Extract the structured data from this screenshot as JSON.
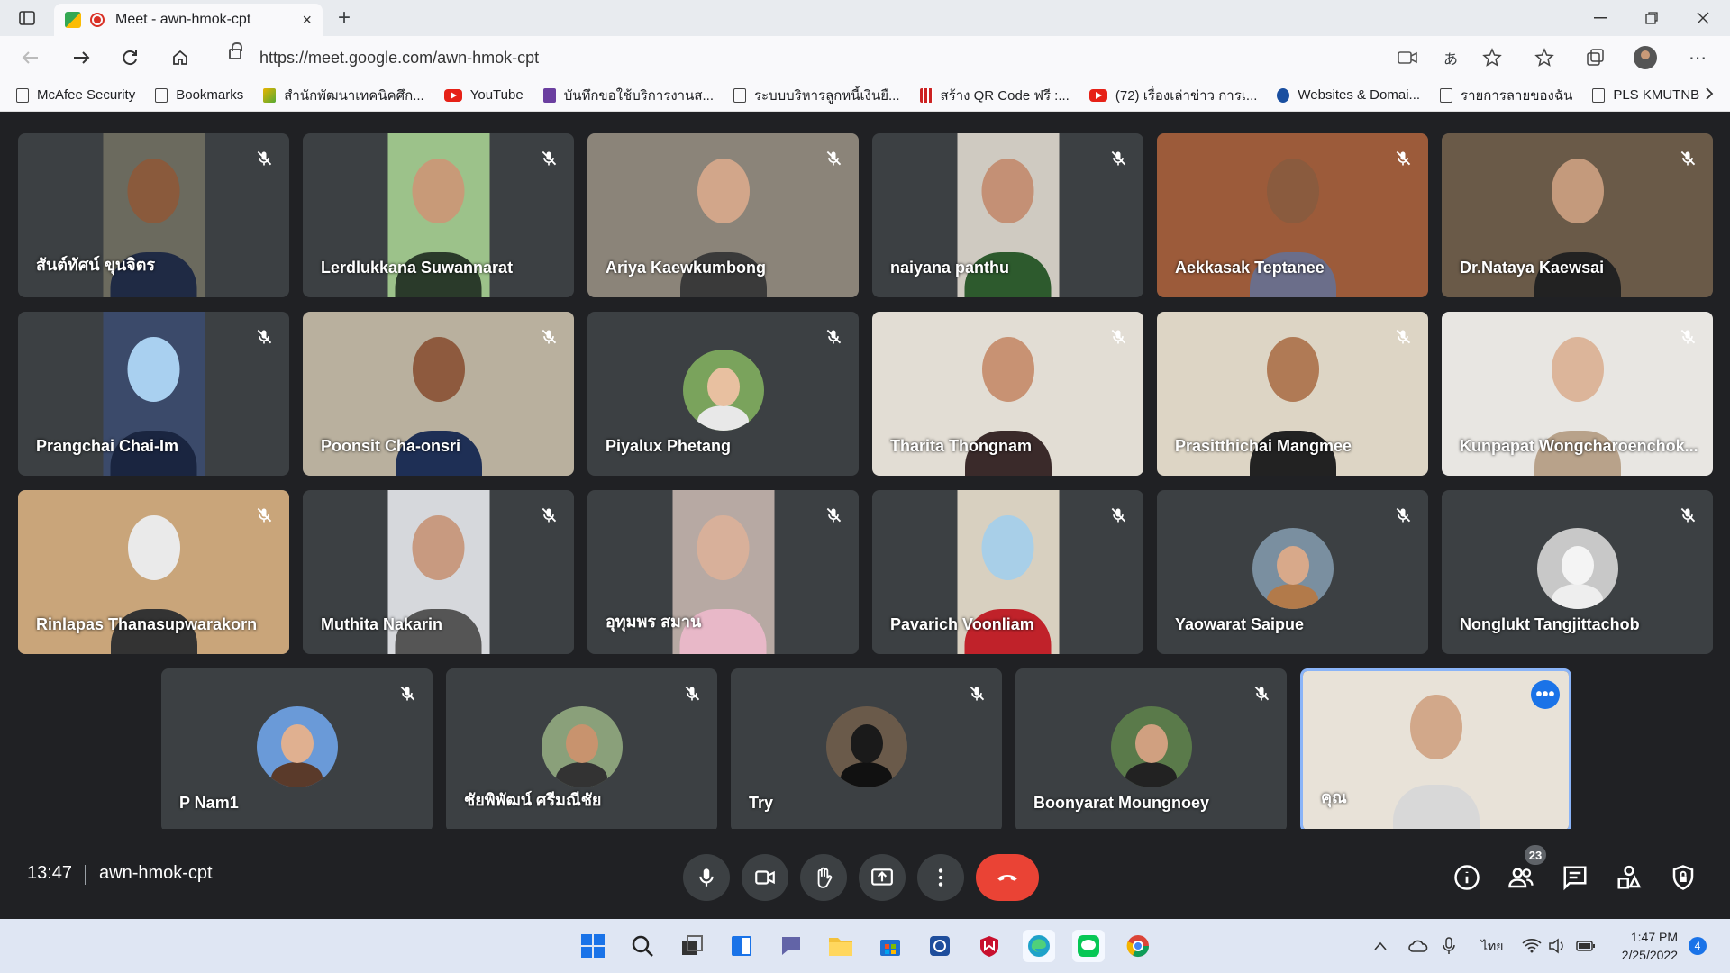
{
  "browser": {
    "tab_title": "Meet - awn-hmok-cpt",
    "tab_close": "×",
    "new_tab": "+",
    "url": "https://meet.google.com/awn-hmok-cpt",
    "bookmarks": [
      {
        "label": "McAfee Security",
        "icon": "page"
      },
      {
        "label": "Bookmarks",
        "icon": "page"
      },
      {
        "label": "สำนักพัฒนาเทคนิคศึก...",
        "icon": "col"
      },
      {
        "label": "YouTube",
        "icon": "yt"
      },
      {
        "label": "บันทึกขอใช้บริการงานส...",
        "icon": "sq"
      },
      {
        "label": "ระบบบริหารลูกหนี้เงินยื...",
        "icon": "page"
      },
      {
        "label": "สร้าง QR Code ฟรี :...",
        "icon": "qr"
      },
      {
        "label": "(72) เรื่องเล่าข่าว การเ...",
        "icon": "yt"
      },
      {
        "label": "Websites & Domai...",
        "icon": "pw"
      },
      {
        "label": "รายการลายของฉัน",
        "icon": "page"
      },
      {
        "label": "PLS KMUTNB",
        "icon": "page"
      }
    ]
  },
  "participants": [
    {
      "name": "สันต์ทัศน์ ขุนจิตร",
      "mode": "video",
      "bg": "#6b6a5e",
      "face": "#8a5a3c",
      "body": "#1f2a44",
      "full": false
    },
    {
      "name": "Lerdlukkana Suwannarat",
      "mode": "video",
      "bg": "#9cc28a",
      "face": "#c89a78",
      "body": "#2a3a2a",
      "full": false
    },
    {
      "name": "Ariya Kaewkumbong",
      "mode": "video",
      "bg": "#8b8479",
      "face": "#d2a68a",
      "body": "#3a3a3a",
      "full": true
    },
    {
      "name": "naiyana panthu",
      "mode": "video",
      "bg": "#cfcac1",
      "face": "#c49075",
      "body": "#2d5a2d",
      "full": false
    },
    {
      "name": "Aekkasak Teptanee",
      "mode": "video",
      "bg": "#9c5b3a",
      "face": "#8a5b3e",
      "body": "#6b6e8a",
      "full": true
    },
    {
      "name": "Dr.Nataya Kaewsai",
      "mode": "video",
      "bg": "#6a5a48",
      "face": "#c49a7c",
      "body": "#222",
      "full": true
    },
    {
      "name": "Prangchai Chai-Im",
      "mode": "video",
      "bg": "#3b4a6a",
      "face": "#a9d0f0",
      "body": "#1a2540",
      "full": false
    },
    {
      "name": "Poonsit Cha-onsri",
      "mode": "video",
      "bg": "#b9b09e",
      "face": "#8e5a3e",
      "body": "#1e2f55",
      "full": true
    },
    {
      "name": "Piyalux Phetang",
      "mode": "avatar",
      "avbg": "#7aa35c",
      "face": "#e8c0a0",
      "body": "#e8e8e8"
    },
    {
      "name": "Tharita Thongnam",
      "mode": "video",
      "bg": "#e2ddd4",
      "face": "#c89273",
      "body": "#3a2a2a",
      "full": true
    },
    {
      "name": "Prasitthichai Mangmee",
      "mode": "video",
      "bg": "#ddd5c5",
      "face": "#b07a55",
      "body": "#222",
      "full": true
    },
    {
      "name": "Kunpapat Wongcharoenchok...",
      "mode": "video",
      "bg": "#e8e6e2",
      "face": "#dcb59a",
      "body": "#b8a28a",
      "full": true
    },
    {
      "name": "Rinlapas Thanasupwarakorn",
      "mode": "video",
      "bg": "#c9a57a",
      "face": "#eaeaea",
      "body": "#333",
      "full": true
    },
    {
      "name": "Muthita Nakarin",
      "mode": "video",
      "bg": "#d6d8dc",
      "face": "#c89a80",
      "body": "#555",
      "full": false
    },
    {
      "name": "อุทุมพร สมาน",
      "mode": "video",
      "bg": "#b7a9a3",
      "face": "#d8b09a",
      "body": "#e8b8c8",
      "full": false
    },
    {
      "name": "Pavarich Voonliam",
      "mode": "video",
      "bg": "#d8d0c0",
      "face": "#a8cfe8",
      "body": "#c0222a",
      "full": false
    },
    {
      "name": "Yaowarat Saipue",
      "mode": "avatar",
      "avbg": "#7a8fa0",
      "face": "#d8a98a",
      "body": "#b27a4a"
    },
    {
      "name": "Nonglukt Tangjittachob",
      "mode": "avatar",
      "avbg": "#c8c8c8",
      "face": "#f4f4f4",
      "body": "#eee"
    },
    {
      "name": "P Nam1",
      "mode": "avatar",
      "avbg": "#6a9ad8",
      "face": "#e0b090",
      "body": "#5a3a2a"
    },
    {
      "name": "ชัยพิพัฒน์ ศรีมณีชัย",
      "mode": "avatar",
      "avbg": "#8aa07a",
      "face": "#c8936e",
      "body": "#333"
    },
    {
      "name": "Try",
      "mode": "avatar",
      "avbg": "#6a5a4a",
      "face": "#1a1a1a",
      "body": "#111"
    },
    {
      "name": "Boonyarat Moungnoey",
      "mode": "avatar",
      "avbg": "#5a7a4a",
      "face": "#d0a080",
      "body": "#222"
    },
    {
      "name": "คุณ",
      "mode": "self",
      "bg": "#e8e2d8",
      "face": "#d2a88a",
      "body": "#d8d8d8",
      "full": true
    }
  ],
  "meeting": {
    "time": "13:47",
    "code": "awn-hmok-cpt",
    "participant_count": "23",
    "more_dots": "•••"
  },
  "taskbar": {
    "lang": "ไทย",
    "time": "1:47 PM",
    "date": "2/25/2022",
    "notifications": "4"
  },
  "colors": {
    "end_call": "#ea4335",
    "self_border": "#8ab4f8",
    "meet_bg": "#202124",
    "tile_bg": "#3c4043"
  }
}
